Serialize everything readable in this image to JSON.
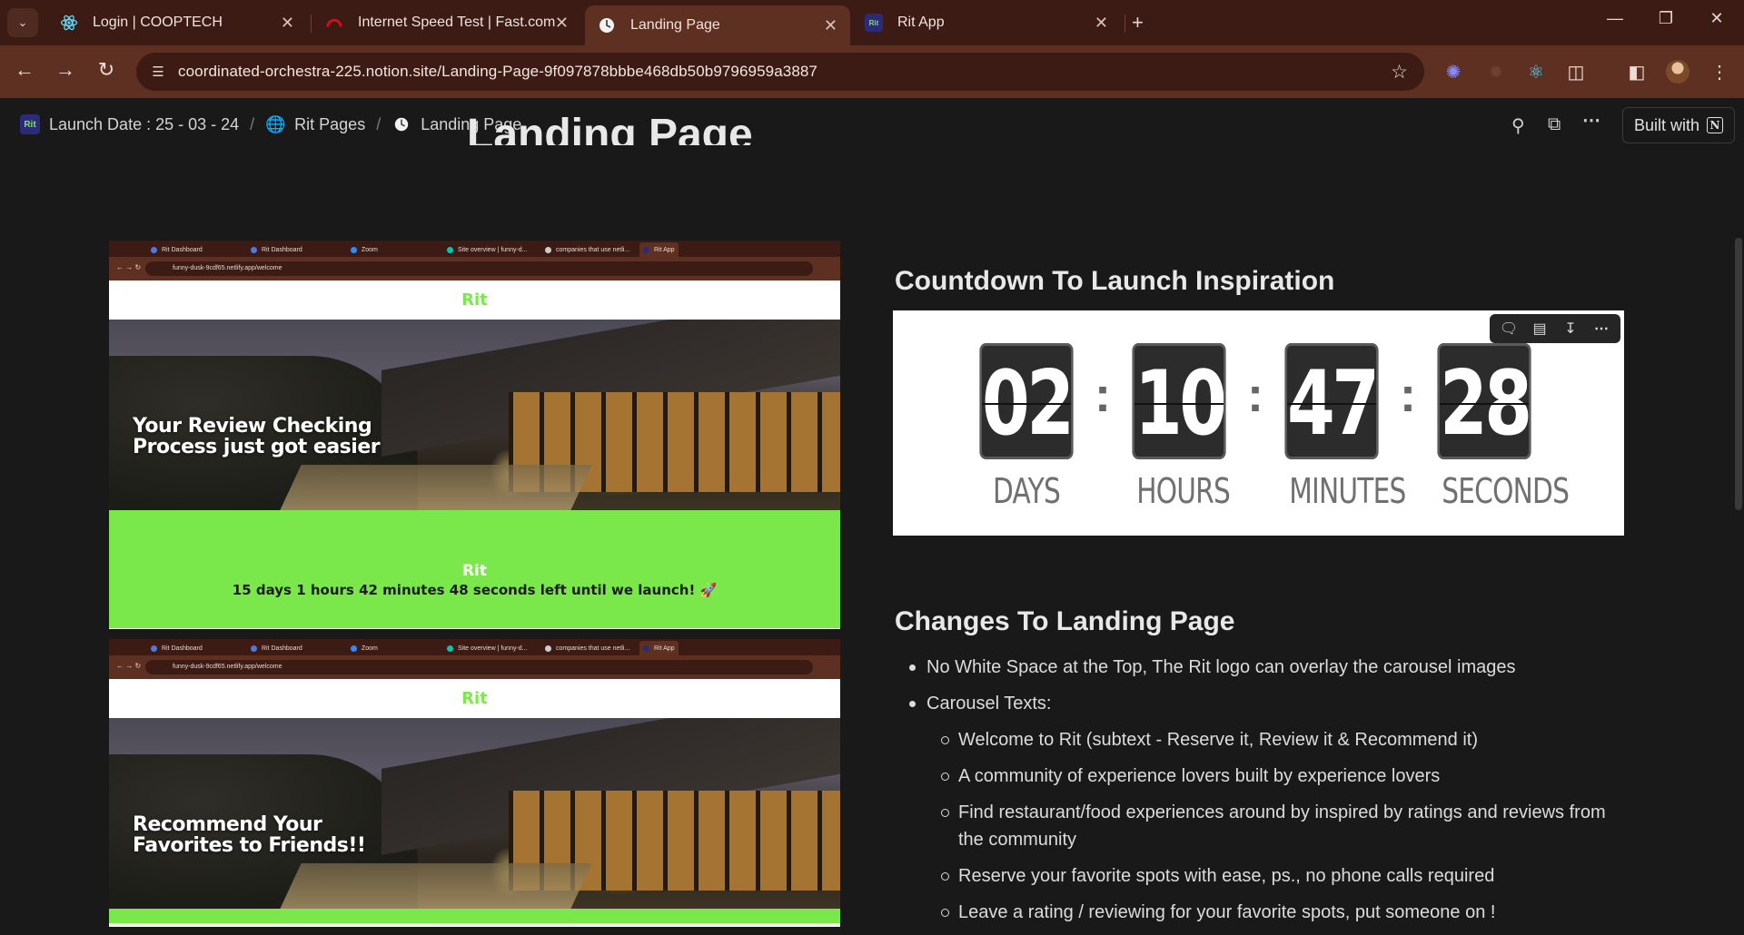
{
  "browser": {
    "tabs": [
      {
        "title": "Login | COOPTECH",
        "icon": "react-icon",
        "color": "#61dafb"
      },
      {
        "title": "Internet Speed Test | Fast.com",
        "icon": "fast-icon",
        "color": "#e50914"
      },
      {
        "title": "Landing Page",
        "icon": "clock-icon",
        "color": "#ffffff"
      },
      {
        "title": "Rit App",
        "icon": "rit-icon",
        "color": "#2b2b7a"
      }
    ],
    "url": "coordinated-orchestra-225.notion.site/Landing-Page-9f097878bbbe468db50b9796959a3887"
  },
  "breadcrumb": {
    "items": [
      "Launch Date : 25 - 03 - 24",
      "Rit Pages",
      "Landing Page"
    ],
    "rit_badge": "Rit"
  },
  "notion": {
    "built_with": "Built with",
    "notion_logo": "N"
  },
  "page": {
    "title": "Landing Page",
    "screenshot1": {
      "mini_tabs": [
        "Rit Dashboard",
        "Rit Dashboard",
        "Zoom",
        "Site overview | funny-d...",
        "companies that use netli...",
        "Rit App"
      ],
      "mini_url": "funny-dusk-9cdf65.netlify.app/welcome",
      "logo": "Rit",
      "hero_text": "Your Review Checking Process just got easier",
      "banner_logo": "Rit",
      "banner_text": "15 days 1 hours 42 minutes 48 seconds left until we launch! 🚀"
    },
    "screenshot2": {
      "mini_tabs": [
        "Rit Dashboard",
        "Rit Dashboard",
        "Zoom",
        "Site overview | funny-d...",
        "companies that use netli...",
        "Rit App"
      ],
      "mini_url": "funny-dusk-9cdf65.netlify.app/welcome",
      "logo": "Rit",
      "hero_text": "Recommend Your Favorites to Friends!!"
    },
    "countdown_heading": "Countdown To Launch Inspiration",
    "countdown": [
      {
        "value": "02",
        "label": "DAYS"
      },
      {
        "value": "10",
        "label": "HOURS"
      },
      {
        "value": "47",
        "label": "MINUTES"
      },
      {
        "value": "28",
        "label": "SECONDS"
      }
    ],
    "changes_heading": "Changes To Landing Page",
    "changes": [
      {
        "level": 1,
        "text": "No White Space at the Top, The Rit logo can overlay the carousel images"
      },
      {
        "level": 1,
        "text": "Carousel Texts:"
      },
      {
        "level": 2,
        "text": "Welcome to Rit (subtext - Reserve it, Review it & Recommend it)"
      },
      {
        "level": 2,
        "text": "A community of experience lovers built by experience lovers"
      },
      {
        "level": 2,
        "text": "Find restaurant/food experiences around by inspired by ratings and reviews from the community"
      },
      {
        "level": 2,
        "text": "Reserve your favorite spots with ease, ps., no phone calls required"
      },
      {
        "level": 2,
        "text": "Leave a rating / reviewing for your favorite spots, put someone on !"
      }
    ]
  },
  "colors": {
    "rit_green": "#7ae84a",
    "chrome_dark": "#3b1b13",
    "chrome_mid": "#5e3021",
    "notion_bg": "#191919"
  }
}
